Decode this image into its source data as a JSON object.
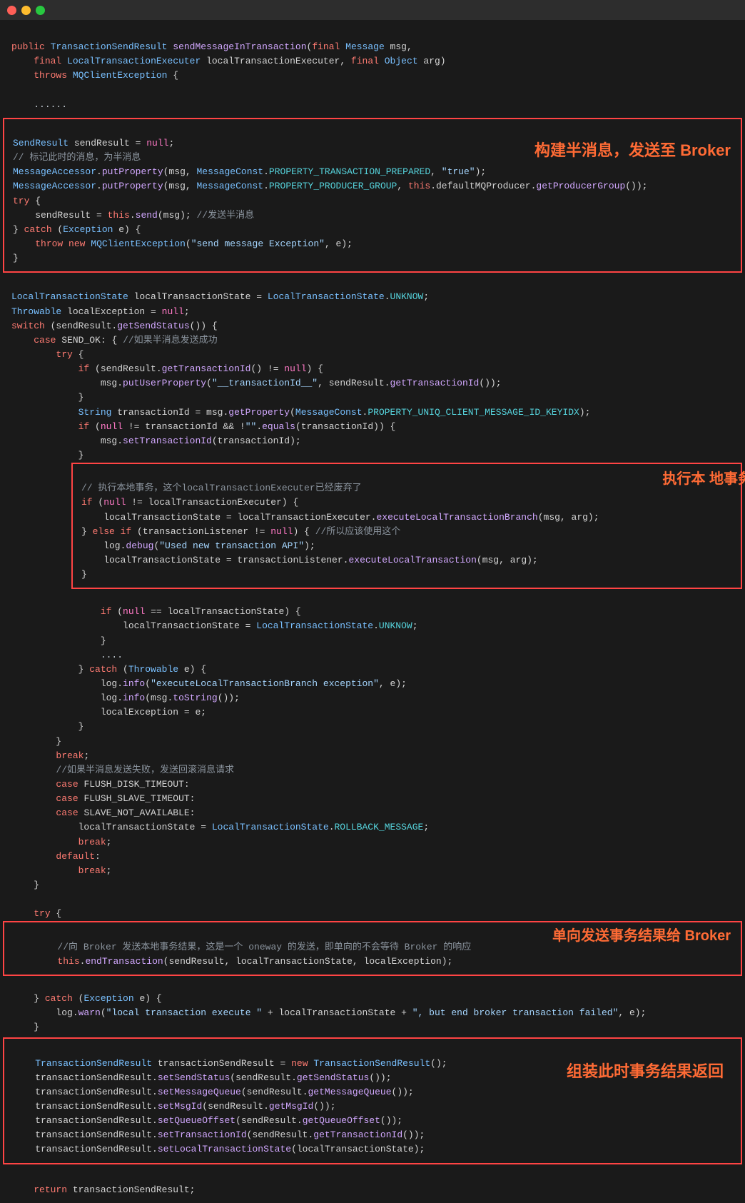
{
  "titleBar": {
    "buttons": [
      "close",
      "minimize",
      "maximize"
    ]
  },
  "annotations": {
    "buildHalfMsg": "构建半消息，发送至 Broker",
    "executeLocalTx": "执行本\n地事务",
    "sendTxResult": "单向发送事务结果给 Broker",
    "assembleTxResult": "组装此时事务结果返回"
  },
  "code": "public TransactionSendResult sendMessageInTransaction(final Message msg,\n    final LocalTransactionExecuter localTransactionExecuter, final Object arg)\n    throws MQClientException {\n\n    ......\n    SendResult sendResult = null;\n    // 标记此时的消息，为半消息\n    MessageAccessor.putProperty(msg, MessageConst.PROPERTY_TRANSACTION_PREPARED, \"true\");\n    MessageAccessor.putProperty(msg, MessageConst.PROPERTY_PRODUCER_GROUP, this.defaultMQProducer.getProducerGroup());\n    try {\n        sendResult = this.send(msg); //发送半消息\n    } catch (Exception e) {\n        throw new MQClientException(\"send message Exception\", e);\n    }\n\n    LocalTransactionState localTransactionState = LocalTransactionState.UNKNOW;\n    Throwable localException = null;\n    switch (sendResult.getSendStatus()) {\n        case SEND_OK: { //如果半消息发送成功\n            try {\n                if (sendResult.getTransactionId() != null) {\n                    msg.putUserProperty(\"__transactionId__\", sendResult.getTransactionId());\n                }\n                String transactionId = msg.getProperty(MessageConst.PROPERTY_UNIQ_CLIENT_MESSAGE_ID_KEYIDX);\n                if (null != transactionId && !\"\".equals(transactionId)) {\n                    msg.setTransactionId(transactionId);\n                }\n                // 执行本地事务，这个localTransactionExecuter已经废弃了\n                if (null != localTransactionExecuter) {\n                    localTransactionState = localTransactionExecuter.executeLocalTransactionBranch(msg, arg);\n                } else if (transactionListener != null) { //所以应该使用这个\n                    log.debug(\"Used new transaction API\");\n                    localTransactionState = transactionListener.executeLocalTransaction(msg, arg);\n                }\n                if (null == localTransactionState) {\n                    localTransactionState = LocalTransactionState.UNKNOW;\n                }\n                ....\n            } catch (Throwable e) {\n                log.info(\"executeLocalTransactionBranch exception\", e);\n                log.info(msg.toString());\n                localException = e;\n            }\n        }\n        break;\n        //如果半消息发送失败，发送回滚消息请求\n        case FLUSH_DISK_TIMEOUT:\n        case FLUSH_SLAVE_TIMEOUT:\n        case SLAVE_NOT_AVAILABLE:\n            localTransactionState = LocalTransactionState.ROLLBACK_MESSAGE;\n            break;\n        default:\n            break;\n    }\n\n    try {\n        //向 Broker 发送本地事务结果，这是一个 oneway 的发送，即单向的不会等待 Broker 的响应\n        this.endTransaction(sendResult, localTransactionState, localException);\n    } catch (Exception e) {\n        log.warn(\"local transaction execute \" + localTransactionState + \", but end broker transaction failed\", e);\n    }\n\n    TransactionSendResult transactionSendResult = new TransactionSendResult();\n    transactionSendResult.setSendStatus(sendResult.getSendStatus());\n    transactionSendResult.setMessageQueue(sendResult.getMessageQueue());\n    transactionSendResult.setMsgId(sendResult.getMsgId());\n    transactionSendResult.setQueueOffset(sendResult.getQueueOffset());\n    transactionSendResult.setTransactionId(sendResult.getTransactionId());\n    transactionSendResult.setLocalTransactionState(localTransactionState);\n\n    return transactionSendResult;"
}
